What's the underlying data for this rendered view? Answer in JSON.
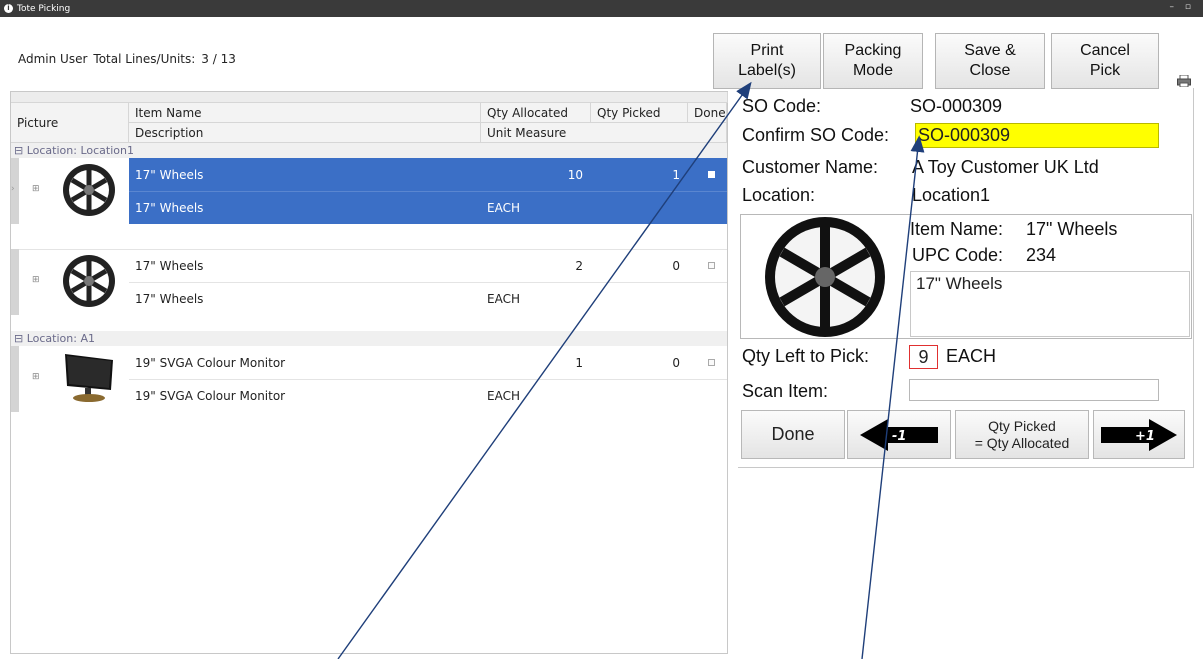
{
  "window": {
    "title": "Tote Picking",
    "controls": "– ▫"
  },
  "header": {
    "user": "Admin User",
    "totals_label": "Total Lines/Units:",
    "totals_value": "3 / 13"
  },
  "toolbar": {
    "print_label": "Print\nLabel(s)",
    "packing_mode": "Packing\nMode",
    "save_close": "Save &\nClose",
    "cancel_pick": "Cancel\nPick"
  },
  "grid": {
    "headers": {
      "picture": "Picture",
      "item_name": "Item Name",
      "description": "Description",
      "qty_allocated": "Qty Allocated",
      "unit_measure": "Unit Measure",
      "qty_picked": "Qty Picked",
      "done": "Done"
    },
    "groups": [
      {
        "label": "Location: Location1"
      },
      {
        "label": "Location: A1"
      }
    ],
    "rows": [
      {
        "item_name": "17\" Wheels",
        "description": "17\" Wheels",
        "qty_allocated": "10",
        "unit": "EACH",
        "qty_picked": "1"
      },
      {
        "item_name": "17\" Wheels",
        "description": "17\" Wheels",
        "qty_allocated": "2",
        "unit": "EACH",
        "qty_picked": "0"
      },
      {
        "item_name": "19\" SVGA Colour Monitor",
        "description": "19\" SVGA Colour Monitor",
        "qty_allocated": "1",
        "unit": "EACH",
        "qty_picked": "0"
      }
    ]
  },
  "panel": {
    "so_code_label": "SO Code:",
    "so_code_value": "SO-000309",
    "confirm_label": "Confirm SO Code:",
    "confirm_value": "SO-000309",
    "customer_label": "Customer Name:",
    "customer_value": "A Toy Customer UK Ltd",
    "location_label": "Location:",
    "location_value": "Location1",
    "item_name_label": "Item Name:",
    "item_name_value": "17\" Wheels",
    "upc_label": "UPC Code:",
    "upc_value": "234",
    "description_value": "17\" Wheels",
    "qty_left_label": "Qty Left to Pick:",
    "qty_left_value": "9",
    "qty_left_unit": "EACH",
    "scan_label": "Scan Item:",
    "done_button": "Done",
    "minus_label": "-1",
    "qty_picked_eq": "Qty Picked\n= Qty Allocated",
    "plus_label": "+1"
  },
  "colors": {
    "selection": "#3b6fc6",
    "confirm_bg": "#ffff00",
    "qty_left_border": "#e03030"
  }
}
